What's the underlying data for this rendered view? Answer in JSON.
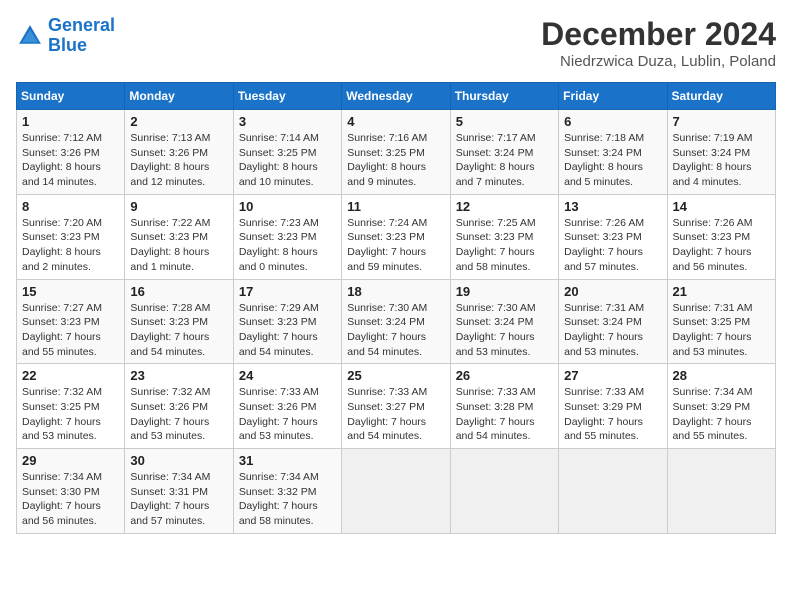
{
  "header": {
    "logo_line1": "General",
    "logo_line2": "Blue",
    "month": "December 2024",
    "location": "Niedrzwica Duza, Lublin, Poland"
  },
  "weekdays": [
    "Sunday",
    "Monday",
    "Tuesday",
    "Wednesday",
    "Thursday",
    "Friday",
    "Saturday"
  ],
  "weeks": [
    [
      {
        "day": "1",
        "info": "Sunrise: 7:12 AM\nSunset: 3:26 PM\nDaylight: 8 hours\nand 14 minutes."
      },
      {
        "day": "2",
        "info": "Sunrise: 7:13 AM\nSunset: 3:26 PM\nDaylight: 8 hours\nand 12 minutes."
      },
      {
        "day": "3",
        "info": "Sunrise: 7:14 AM\nSunset: 3:25 PM\nDaylight: 8 hours\nand 10 minutes."
      },
      {
        "day": "4",
        "info": "Sunrise: 7:16 AM\nSunset: 3:25 PM\nDaylight: 8 hours\nand 9 minutes."
      },
      {
        "day": "5",
        "info": "Sunrise: 7:17 AM\nSunset: 3:24 PM\nDaylight: 8 hours\nand 7 minutes."
      },
      {
        "day": "6",
        "info": "Sunrise: 7:18 AM\nSunset: 3:24 PM\nDaylight: 8 hours\nand 5 minutes."
      },
      {
        "day": "7",
        "info": "Sunrise: 7:19 AM\nSunset: 3:24 PM\nDaylight: 8 hours\nand 4 minutes."
      }
    ],
    [
      {
        "day": "8",
        "info": "Sunrise: 7:20 AM\nSunset: 3:23 PM\nDaylight: 8 hours\nand 2 minutes."
      },
      {
        "day": "9",
        "info": "Sunrise: 7:22 AM\nSunset: 3:23 PM\nDaylight: 8 hours\nand 1 minute."
      },
      {
        "day": "10",
        "info": "Sunrise: 7:23 AM\nSunset: 3:23 PM\nDaylight: 8 hours\nand 0 minutes."
      },
      {
        "day": "11",
        "info": "Sunrise: 7:24 AM\nSunset: 3:23 PM\nDaylight: 7 hours\nand 59 minutes."
      },
      {
        "day": "12",
        "info": "Sunrise: 7:25 AM\nSunset: 3:23 PM\nDaylight: 7 hours\nand 58 minutes."
      },
      {
        "day": "13",
        "info": "Sunrise: 7:26 AM\nSunset: 3:23 PM\nDaylight: 7 hours\nand 57 minutes."
      },
      {
        "day": "14",
        "info": "Sunrise: 7:26 AM\nSunset: 3:23 PM\nDaylight: 7 hours\nand 56 minutes."
      }
    ],
    [
      {
        "day": "15",
        "info": "Sunrise: 7:27 AM\nSunset: 3:23 PM\nDaylight: 7 hours\nand 55 minutes."
      },
      {
        "day": "16",
        "info": "Sunrise: 7:28 AM\nSunset: 3:23 PM\nDaylight: 7 hours\nand 54 minutes."
      },
      {
        "day": "17",
        "info": "Sunrise: 7:29 AM\nSunset: 3:23 PM\nDaylight: 7 hours\nand 54 minutes."
      },
      {
        "day": "18",
        "info": "Sunrise: 7:30 AM\nSunset: 3:24 PM\nDaylight: 7 hours\nand 54 minutes."
      },
      {
        "day": "19",
        "info": "Sunrise: 7:30 AM\nSunset: 3:24 PM\nDaylight: 7 hours\nand 53 minutes."
      },
      {
        "day": "20",
        "info": "Sunrise: 7:31 AM\nSunset: 3:24 PM\nDaylight: 7 hours\nand 53 minutes."
      },
      {
        "day": "21",
        "info": "Sunrise: 7:31 AM\nSunset: 3:25 PM\nDaylight: 7 hours\nand 53 minutes."
      }
    ],
    [
      {
        "day": "22",
        "info": "Sunrise: 7:32 AM\nSunset: 3:25 PM\nDaylight: 7 hours\nand 53 minutes."
      },
      {
        "day": "23",
        "info": "Sunrise: 7:32 AM\nSunset: 3:26 PM\nDaylight: 7 hours\nand 53 minutes."
      },
      {
        "day": "24",
        "info": "Sunrise: 7:33 AM\nSunset: 3:26 PM\nDaylight: 7 hours\nand 53 minutes."
      },
      {
        "day": "25",
        "info": "Sunrise: 7:33 AM\nSunset: 3:27 PM\nDaylight: 7 hours\nand 54 minutes."
      },
      {
        "day": "26",
        "info": "Sunrise: 7:33 AM\nSunset: 3:28 PM\nDaylight: 7 hours\nand 54 minutes."
      },
      {
        "day": "27",
        "info": "Sunrise: 7:33 AM\nSunset: 3:29 PM\nDaylight: 7 hours\nand 55 minutes."
      },
      {
        "day": "28",
        "info": "Sunrise: 7:34 AM\nSunset: 3:29 PM\nDaylight: 7 hours\nand 55 minutes."
      }
    ],
    [
      {
        "day": "29",
        "info": "Sunrise: 7:34 AM\nSunset: 3:30 PM\nDaylight: 7 hours\nand 56 minutes."
      },
      {
        "day": "30",
        "info": "Sunrise: 7:34 AM\nSunset: 3:31 PM\nDaylight: 7 hours\nand 57 minutes."
      },
      {
        "day": "31",
        "info": "Sunrise: 7:34 AM\nSunset: 3:32 PM\nDaylight: 7 hours\nand 58 minutes."
      },
      null,
      null,
      null,
      null
    ]
  ]
}
